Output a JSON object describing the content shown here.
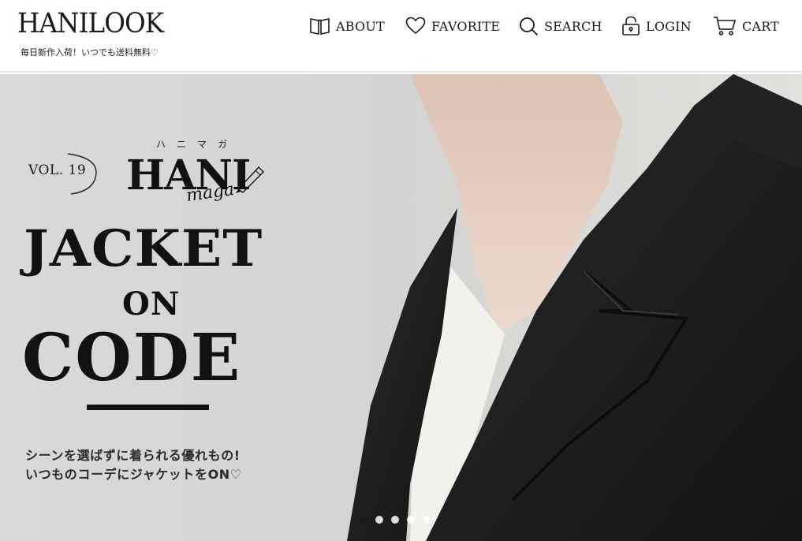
{
  "header": {
    "logo": "HANILOOK",
    "tagline": "毎日新作入荷！いつでも送料無料♡",
    "nav": [
      {
        "label": "ABOUT",
        "icon": "book-icon"
      },
      {
        "label": "FAVORITE",
        "icon": "heart-icon"
      },
      {
        "label": "SEARCH",
        "icon": "search-icon"
      },
      {
        "label": "LOGIN",
        "icon": "lock-icon"
      },
      {
        "label": "CART",
        "icon": "cart-icon"
      }
    ]
  },
  "hero": {
    "vol": "VOL. 19",
    "kana": "ハニマガ",
    "brand": "HANI",
    "brand_script": "maga",
    "headline_1": "JACKET",
    "headline_2": "ON",
    "headline_3": "CODE",
    "sub_line_1": "シーンを選ばずに着られる優れもの!",
    "sub_line_2": "いつものコーデにジャケットをON♡",
    "slides": 5,
    "active_slide": 0
  },
  "colors": {
    "background": "#d7d8d5",
    "jacket": "#1c1c1c",
    "text": "#111111",
    "skin": "#e7d2c4"
  }
}
